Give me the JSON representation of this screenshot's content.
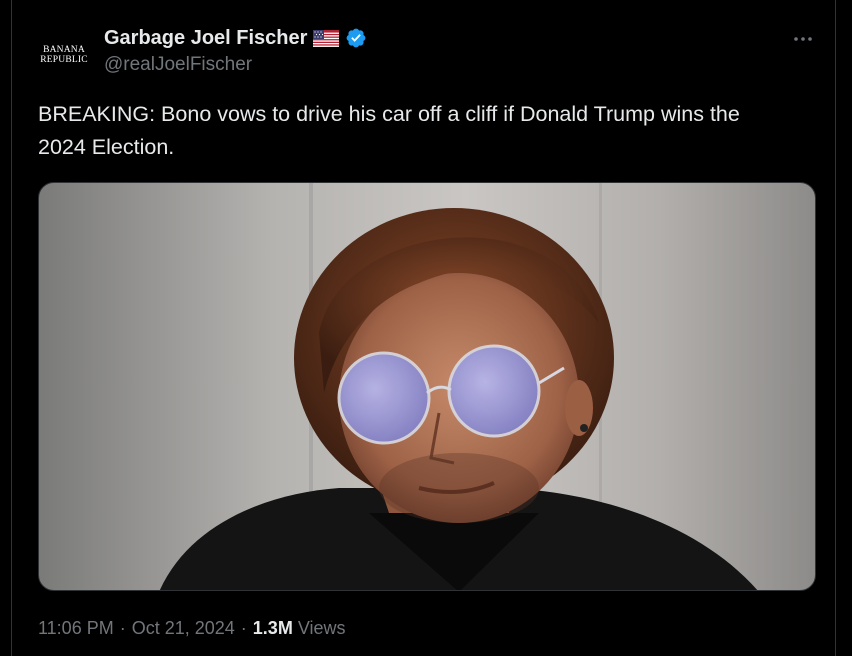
{
  "author": {
    "display_name": "Garbage Joel Fischer",
    "handle": "@realJoelFischer",
    "avatar_text_line1": "BANANA",
    "avatar_text_line2": "REPUBLIC",
    "flag_icon": "us-flag-icon",
    "verified_icon": "verified-badge-icon",
    "verified_color": "#1d9bf0"
  },
  "tweet": {
    "text": "BREAKING: Bono vows to drive his car off a cliff if Donald Trump wins the\n2024 Election.",
    "media_icon": "photo"
  },
  "meta": {
    "time": "11:06 PM",
    "separator": "·",
    "date": "Oct 21, 2024",
    "views_count": "1.3M",
    "views_label": "Views"
  },
  "menu": {
    "more_icon": "more-options-icon"
  },
  "colors": {
    "background": "#000000",
    "text_primary": "#e7e9ea",
    "text_secondary": "#71767b",
    "border": "#2f3336"
  }
}
